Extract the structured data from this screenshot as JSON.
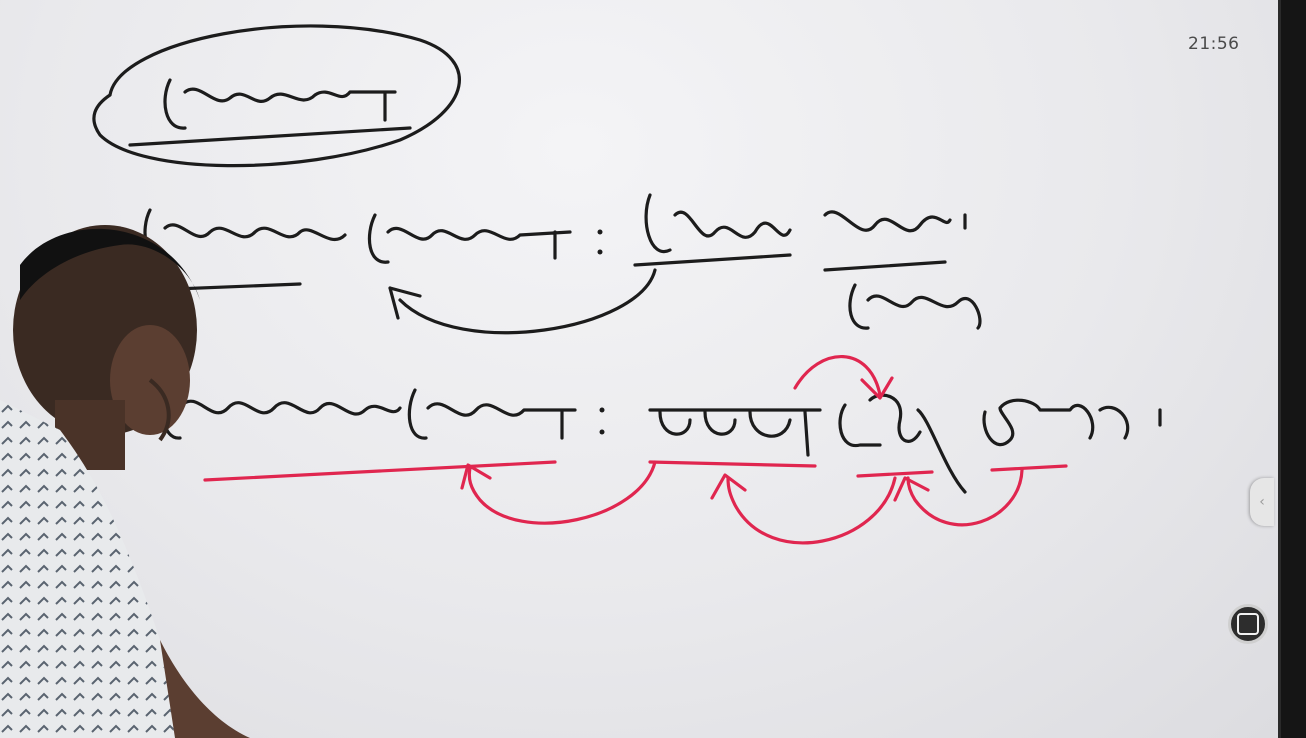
{
  "status": {
    "clock": "21:56"
  },
  "colors": {
    "board": "#ececef",
    "black_ink": "#1c1c1c",
    "red_ink": "#e0264f",
    "bezel": "#151515"
  },
  "controls": {
    "side_handle_icon": "chevron-left-icon",
    "side_handle_glyph": "‹",
    "float_button_icon": "square-icon"
  }
}
